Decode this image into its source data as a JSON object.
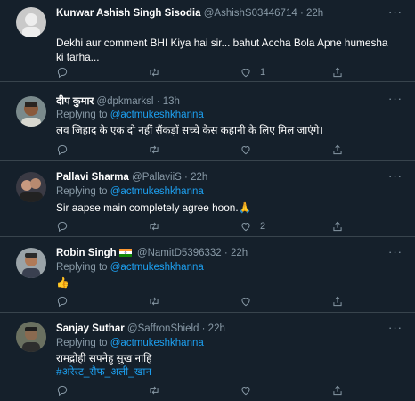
{
  "tweets": [
    {
      "name": "Kunwar Ashish Singh Sisodia",
      "handle": "@AshishS03446714",
      "time": "22h",
      "replying_prefix": "",
      "replying_to": "",
      "text": "Dekhi aur comment BHI Kiya hai sir... bahut Accha Bola Apne humesha ki tarha...",
      "hashtag": "",
      "like_count": "1",
      "reply_count": "",
      "retweet_count": ""
    },
    {
      "name": "दीप कुमार",
      "handle": "@dpkmarksl",
      "time": "13h",
      "replying_prefix": "Replying to",
      "replying_to": "@actmukeshkhanna",
      "text": "लव जिहाद के एक दो नहीं सैंकड़ों सच्चे केस कहानी के लिए मिल जाएंगे।",
      "hashtag": "",
      "like_count": "",
      "reply_count": "",
      "retweet_count": ""
    },
    {
      "name": "Pallavi Sharma",
      "handle": "@PallaviiS",
      "time": "22h",
      "replying_prefix": "Replying to",
      "replying_to": "@actmukeshkhanna",
      "text": "Sir aapse main completely agree hoon.🙏",
      "hashtag": "",
      "like_count": "2",
      "reply_count": "",
      "retweet_count": ""
    },
    {
      "name": "Robin Singh",
      "handle": "@NamitD5396332",
      "time": "22h",
      "replying_prefix": "Replying to",
      "replying_to": "@actmukeshkhanna",
      "text": "👍",
      "hashtag": "",
      "like_count": "",
      "reply_count": "",
      "retweet_count": ""
    },
    {
      "name": "Sanjay Suthar",
      "handle": "@SaffronShield",
      "time": "22h",
      "replying_prefix": "Replying to",
      "replying_to": "@actmukeshkhanna",
      "text": "रामद्रोही सपनेहु सुख नाहि",
      "hashtag": "#अरेस्ट_सैफ_अली_खान",
      "like_count": "",
      "reply_count": "",
      "retweet_count": ""
    }
  ],
  "separator_dot": "·",
  "more_glyph": "···",
  "colors": {
    "background": "#15202b",
    "divider": "#38444d",
    "secondary_text": "#8899a6",
    "link": "#1da1f2"
  },
  "icons": [
    "reply-icon",
    "retweet-icon",
    "like-icon",
    "share-icon",
    "more-icon",
    "india-flag-icon"
  ]
}
